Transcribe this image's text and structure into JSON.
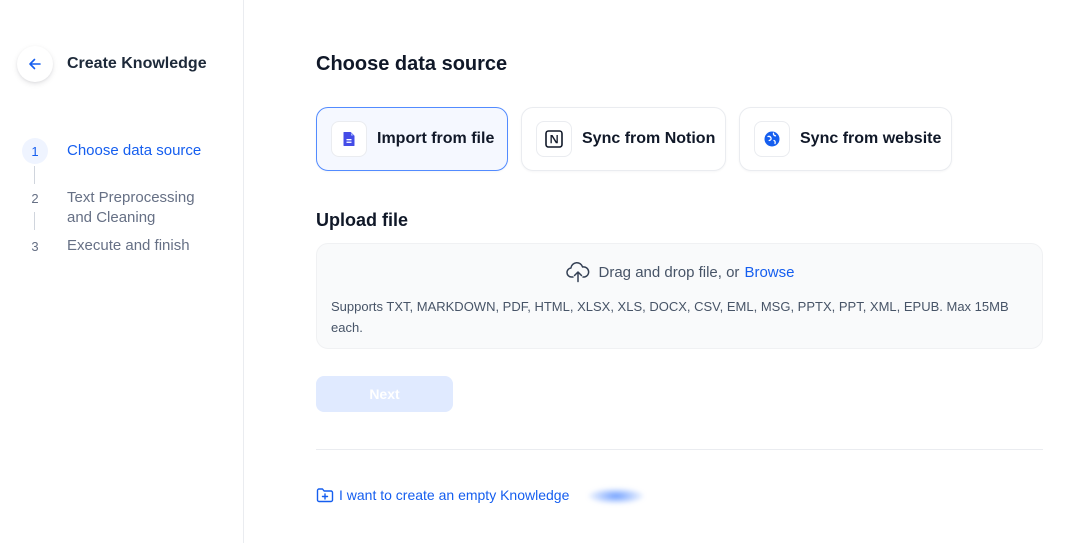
{
  "sidebar": {
    "title": "Create Knowledge",
    "back_icon": "arrow-left-icon",
    "steps": [
      {
        "number": "1",
        "label": "Choose data source",
        "active": true
      },
      {
        "number": "2",
        "label": "Text Preprocessing and Cleaning",
        "active": false
      },
      {
        "number": "3",
        "label": "Execute and finish",
        "active": false
      }
    ]
  },
  "main": {
    "title": "Choose data source",
    "sources": [
      {
        "label": "Import from file",
        "icon": "file-icon",
        "selected": true
      },
      {
        "label": "Sync from Notion",
        "icon": "notion-icon",
        "selected": false
      },
      {
        "label": "Sync from website",
        "icon": "globe-icon",
        "selected": false
      }
    ],
    "upload": {
      "title": "Upload file",
      "drop_text": "Drag and drop file, or",
      "browse_label": "Browse",
      "supports": "Supports TXT, MARKDOWN, PDF, HTML, XLSX, XLS, DOCX, CSV, EML, MSG, PPTX, PPT, XML, EPUB. Max 15MB each."
    },
    "next_label": "Next",
    "empty_link_label": "I want to create an empty Knowledge"
  },
  "colors": {
    "accent": "#155eef",
    "selected_border": "#528bff",
    "disabled_button": "#e0eaff"
  }
}
